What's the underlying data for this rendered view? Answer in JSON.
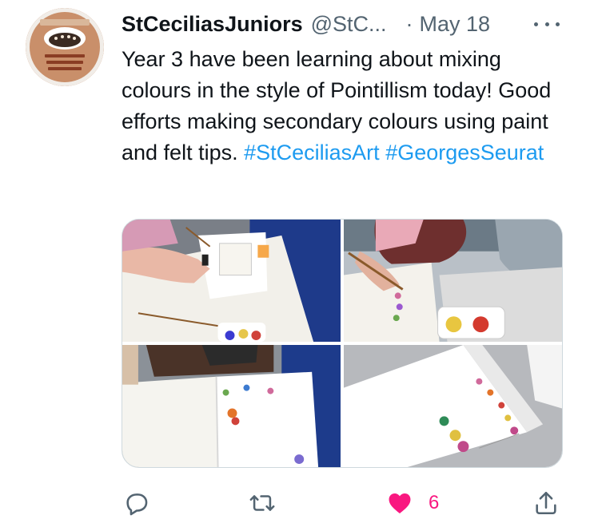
{
  "tweet": {
    "display_name": "StCeciliasJuniors",
    "handle": "@StC...",
    "separator": "·",
    "date": "May 18",
    "text": "Year 3 have been learning about mixing colours in the style of Pointillism today! Good efforts making secondary colours using paint and felt tips.",
    "hashtags": [
      "#StCeciliasArt",
      "#GeorgesSeurat"
    ],
    "avatar_icon": "school-logo",
    "photos": [
      {
        "description_icon": "photo-1"
      },
      {
        "description_icon": "photo-2"
      },
      {
        "description_icon": "photo-3"
      },
      {
        "description_icon": "photo-4"
      }
    ],
    "actions": {
      "reply_icon": "reply-icon",
      "retweet_icon": "retweet-icon",
      "like_icon": "heart-icon",
      "like_count": "6",
      "share_icon": "share-icon"
    },
    "colors": {
      "link": "#1d9bf0",
      "like": "#f91880",
      "secondary_text": "#536471"
    }
  }
}
